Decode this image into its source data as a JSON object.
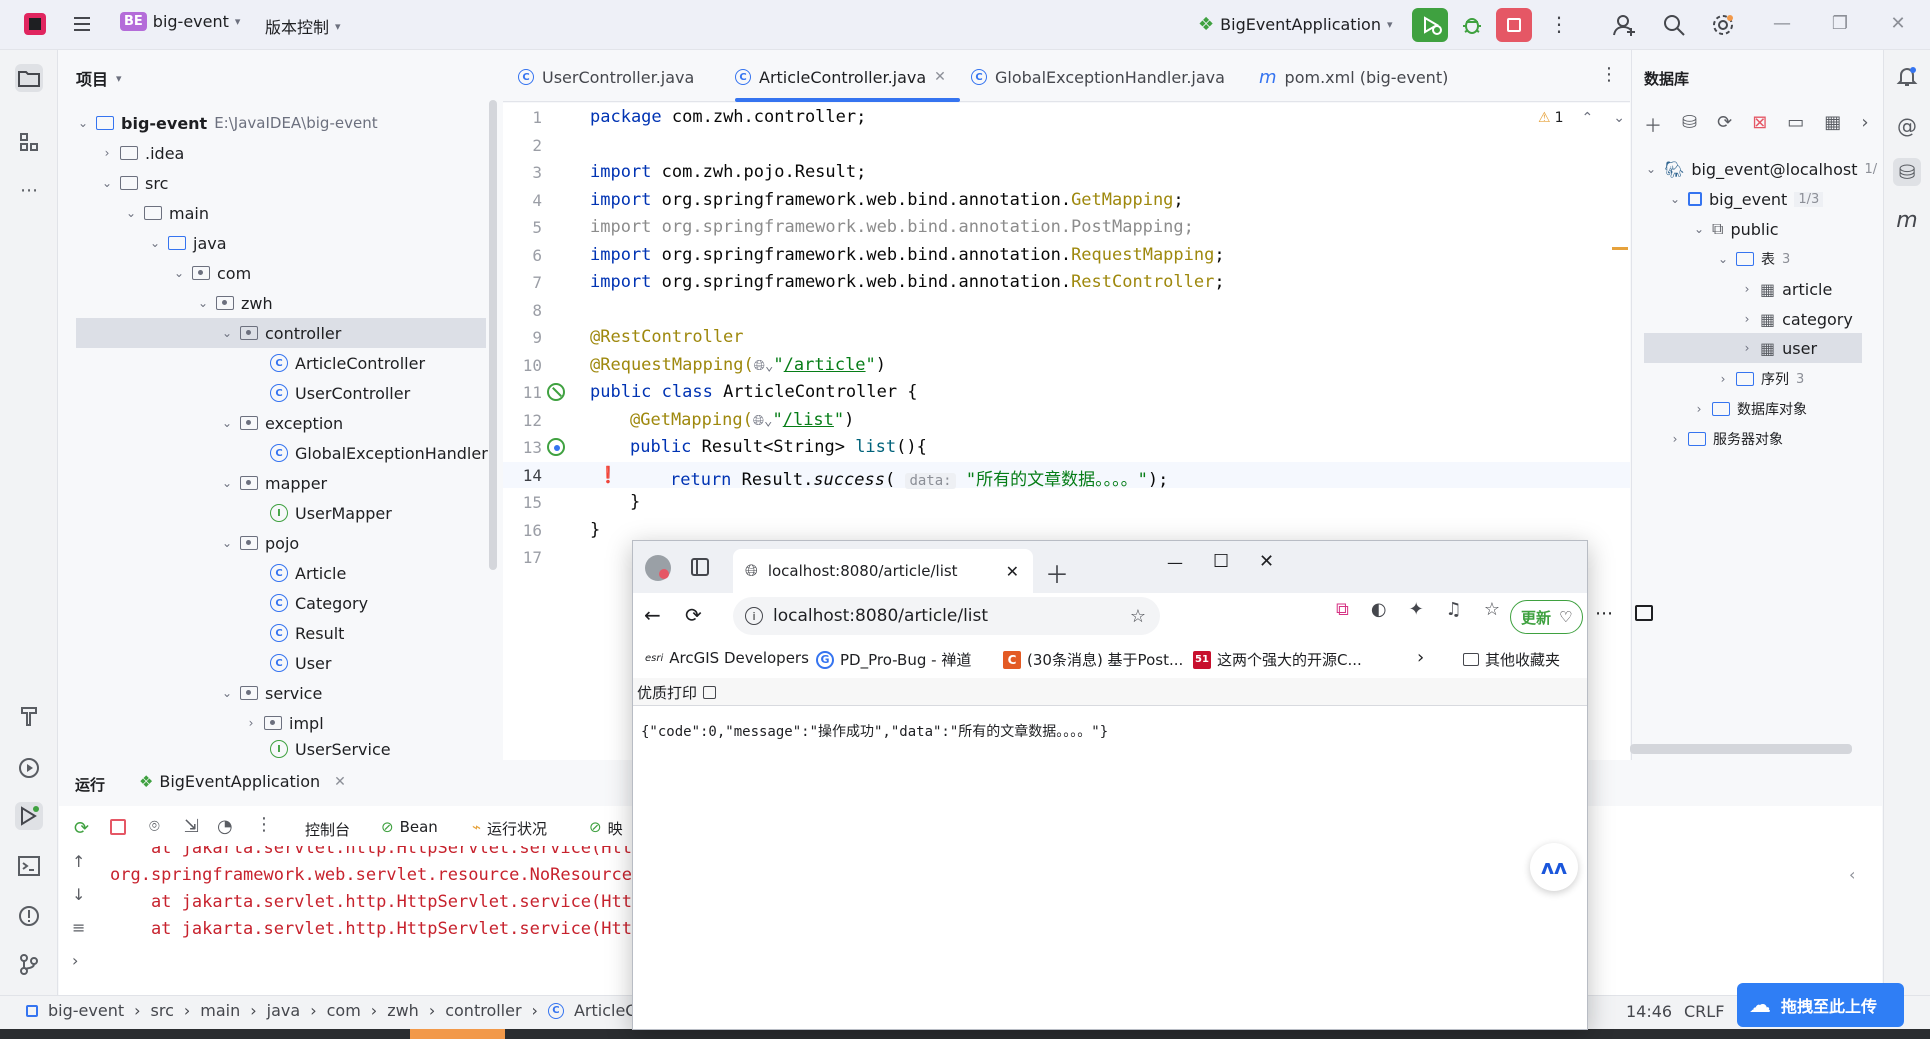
{
  "titlebar": {
    "project_badge": "BE",
    "project_name": "big-event",
    "vcs_label": "版本控制",
    "run_config": "BigEventApplication"
  },
  "project_panel": {
    "title": "项目",
    "root_name": "big-event",
    "root_path": "E:\\JavaIDEA\\big-event",
    "items": [
      {
        "label": ".idea"
      },
      {
        "label": "src"
      },
      {
        "label": "main"
      },
      {
        "label": "java"
      },
      {
        "label": "com"
      },
      {
        "label": "zwh"
      },
      {
        "label": "controller"
      },
      {
        "label": "ArticleController"
      },
      {
        "label": "UserController"
      },
      {
        "label": "exception"
      },
      {
        "label": "GlobalExceptionHandler"
      },
      {
        "label": "mapper"
      },
      {
        "label": "UserMapper"
      },
      {
        "label": "pojo"
      },
      {
        "label": "Article"
      },
      {
        "label": "Category"
      },
      {
        "label": "Result"
      },
      {
        "label": "User"
      },
      {
        "label": "service"
      },
      {
        "label": "impl"
      },
      {
        "label": "UserService"
      }
    ]
  },
  "editor": {
    "tabs": [
      {
        "label": "UserController.java"
      },
      {
        "label": "ArticleController.java"
      },
      {
        "label": "GlobalExceptionHandler.java"
      },
      {
        "label": "pom.xml (big-event)"
      }
    ],
    "warning_count": "1",
    "line_numbers": [
      "1",
      "2",
      "3",
      "4",
      "5",
      "6",
      "7",
      "8",
      "9",
      "10",
      "11",
      "12",
      "13",
      "14",
      "15",
      "16",
      "17"
    ],
    "code": {
      "l1_kw": "package",
      "l1_rest": " com.zwh.controller;",
      "l3_kw": "import",
      "l3_rest": " com.zwh.pojo.Result;",
      "l4_kw": "import",
      "l4_pre": " org.springframework.web.bind.annotation.",
      "l4_ann": "GetMapping",
      "l4_end": ";",
      "l5": "import org.springframework.web.bind.annotation.PostMapping;",
      "l6_kw": "import",
      "l6_pre": " org.springframework.web.bind.annotation.",
      "l6_ann": "RequestMapping",
      "l6_end": ";",
      "l7_kw": "import",
      "l7_pre": " org.springframework.web.bind.annotation.",
      "l7_ann": "RestController",
      "l7_end": ";",
      "l9": "@RestController",
      "l10_ann": "@RequestMapping(",
      "l10_str1": "\"",
      "l10_link": "/article",
      "l10_str2": "\"",
      "l10_end": ")",
      "l11_kw": "public class",
      "l11_rest": " ArticleController {",
      "l12_ann": "@GetMapping(",
      "l12_str1": "\"",
      "l12_link": "/list",
      "l12_str2": "\"",
      "l12_end": ")",
      "l13_kw": "public",
      "l13_rest": " Result<String> ",
      "l13_mth": "list",
      "l13_end": "(){",
      "l14_kw": "return",
      "l14_pre": " Result.",
      "l14_mth": "success",
      "l14_open": "( ",
      "l14_hint": "data:",
      "l14_str": " \"所有的文章数据。。。。\"",
      "l14_end": ");",
      "l15": "}",
      "l16": "}"
    }
  },
  "database_panel": {
    "title": "数据库",
    "tree": [
      {
        "label": "big_event@localhost",
        "badge": "1/"
      },
      {
        "label": "big_event",
        "badge": "1/3"
      },
      {
        "label": "public"
      },
      {
        "label": "表",
        "badge": "3"
      },
      {
        "label": "article"
      },
      {
        "label": "category"
      },
      {
        "label": "user"
      },
      {
        "label": "序列",
        "badge": "3"
      },
      {
        "label": "数据库对象"
      },
      {
        "label": "服务器对象"
      }
    ]
  },
  "run_panel": {
    "title": "运行",
    "tab_label": "BigEventApplication",
    "toolbar": {
      "console": "控制台",
      "bean": "Bean",
      "status": "运行状况",
      "mapping": "映"
    },
    "console_lines": [
      "    at jakarta.servlet.http.HttpServlet.service(Htt",
      "org.springframework.web.servlet.resource.NoResource",
      "    at jakarta.servlet.http.HttpServlet.service(Htt",
      "    at jakarta.servlet.http.HttpServlet.service(Htt"
    ]
  },
  "statusbar": {
    "breadcrumb": [
      "big-event",
      "src",
      "main",
      "java",
      "com",
      "zwh",
      "controller",
      "ArticleCo"
    ],
    "position": "14:46",
    "line_ending": "CRLF"
  },
  "browser": {
    "tab_title": "localhost:8080/article/list",
    "url": "localhost:8080/article/list",
    "update_label": "更新",
    "bookmarks": [
      {
        "label": "ArcGIS Developers",
        "icon": "esri"
      },
      {
        "label": "PD_Pro-Bug - 禅道",
        "icon": "G"
      },
      {
        "label": "(30条消息) 基于Post...",
        "icon": "C"
      },
      {
        "label": "这两个强大的开源C...",
        "icon": "51"
      }
    ],
    "other_bookmarks": "其他收藏夹",
    "print_label": "优质打印",
    "response_text": "{\"code\":0,\"message\":\"操作成功\",\"data\":\"所有的文章数据。。。。\"}"
  },
  "upload_button": "拖拽至此上传",
  "colors": {
    "accent": "#3574f0",
    "run_green": "#3fa140",
    "stop_red": "#e55765",
    "upload_blue": "#2f7ef5"
  }
}
